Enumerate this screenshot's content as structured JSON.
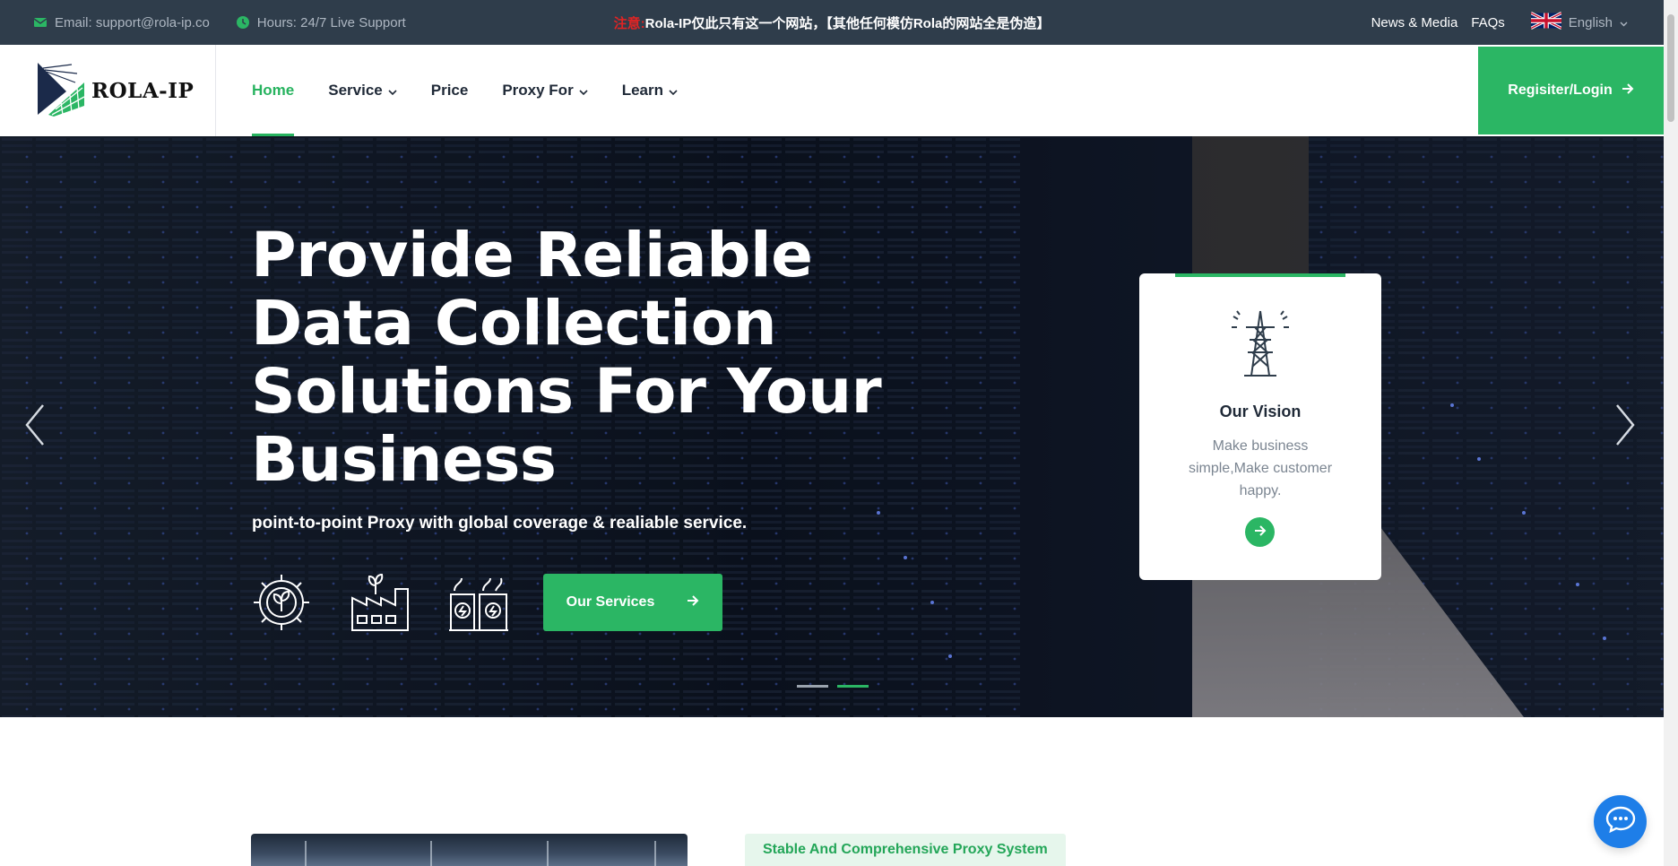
{
  "topbar": {
    "email": "Email: support@rola-ip.co",
    "hours": "Hours: 24/7 Live Support",
    "notice_warn": "注意:",
    "notice_text": "Rola-IP仅此只有这一个网站，【其他任何模仿Rola的网站全是伪造】",
    "links": [
      "News & Media",
      "FAQs"
    ],
    "language": "English"
  },
  "header": {
    "logo_text": "ROLA-IP",
    "nav": [
      {
        "label": "Home",
        "active": true,
        "dropdown": false
      },
      {
        "label": "Service",
        "active": false,
        "dropdown": true
      },
      {
        "label": "Price",
        "active": false,
        "dropdown": false
      },
      {
        "label": "Proxy For",
        "active": false,
        "dropdown": true
      },
      {
        "label": "Learn",
        "active": false,
        "dropdown": true
      }
    ],
    "login_label": "Regisiter/Login"
  },
  "hero": {
    "title": "Provide Reliable Data Collection Solutions For Your Business",
    "subtitle": "point-to-point Proxy with global coverage & realiable service.",
    "cta_label": "Our Services",
    "icons": [
      "gear-leaf-icon",
      "factory-icon",
      "power-plant-icon"
    ],
    "slides": 2,
    "active_slide": 2
  },
  "vision_card": {
    "title": "Our Vision",
    "text": "Make business simple,Make customer happy.",
    "icon": "transmission-tower-icon"
  },
  "below": {
    "tag": "Stable And Comprehensive Proxy System"
  },
  "colors": {
    "accent": "#2bb664",
    "topbar_bg": "#2f3d4b",
    "chat_blue": "#1e7ee8",
    "warn_red": "#e02424"
  }
}
